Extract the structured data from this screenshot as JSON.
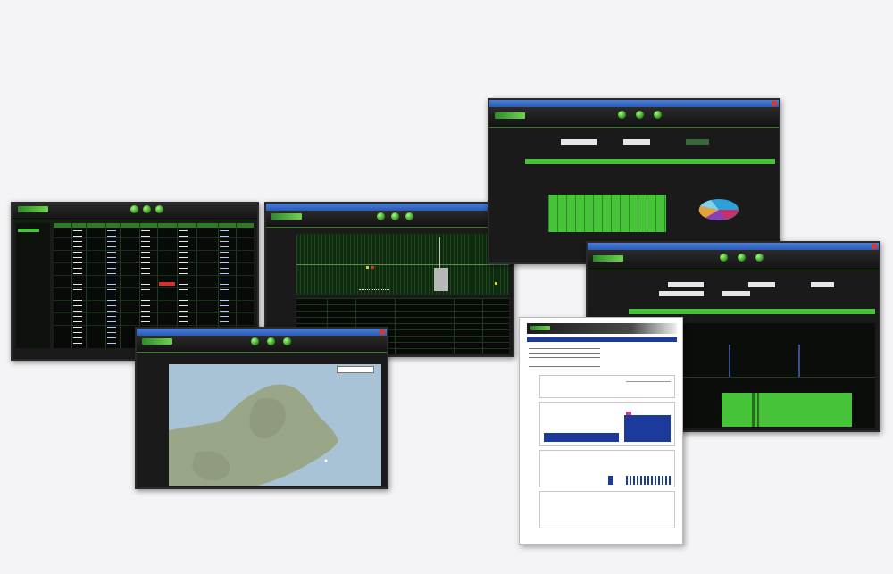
{
  "colors": {
    "background": "#f4f4f6",
    "dark_ui": "#0b0d0b",
    "accent_green": "#47c33a",
    "report_blue": "#1b3a9c",
    "map_water": "#a9c3d6",
    "map_land": "#9aa688"
  },
  "icons": {
    "nav_buttons": "green-orb-icon",
    "window_close": "close-icon"
  }
}
